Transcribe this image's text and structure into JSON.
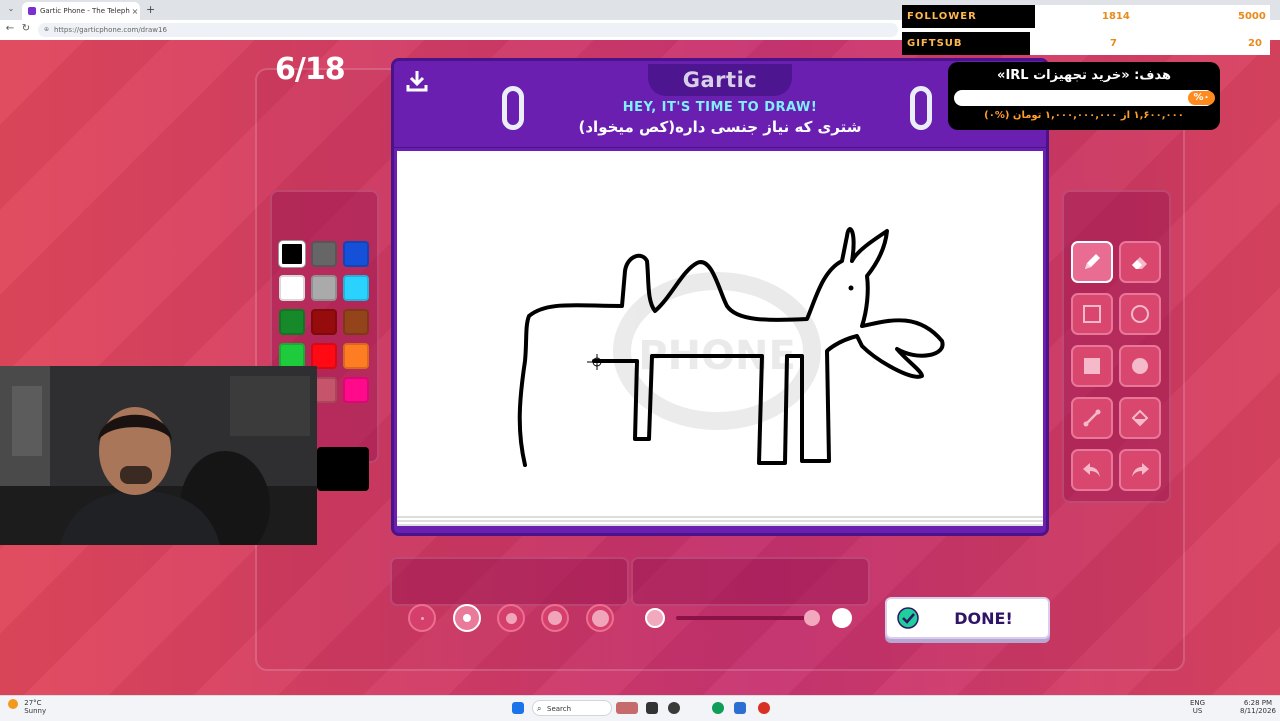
{
  "browser": {
    "tab_title": "Gartic Phone - The Telephone Gar...",
    "tab_close": "×",
    "new_tab": "+",
    "tab_dropdown": "⌄",
    "back": "←",
    "reload": "↻",
    "url": "https://garticphone.com/draw16",
    "lock": "⊕"
  },
  "game": {
    "round": "6/18",
    "logo": "Gartic",
    "heading": "HEY, IT'S TIME TO DRAW!",
    "prompt": "شتری که نیاز جنسی داره(کص میخواد)",
    "watermark": "PHONE",
    "done_label": "DONE!",
    "palette": [
      {
        "color": "#000000",
        "selected": true
      },
      {
        "color": "#666666"
      },
      {
        "color": "#1450d8"
      },
      {
        "color": "#ffffff"
      },
      {
        "color": "#aaaaaa"
      },
      {
        "color": "#2ad2ff"
      },
      {
        "color": "#168a2a"
      },
      {
        "color": "#960c0c"
      },
      {
        "color": "#93441b"
      },
      {
        "color": "#1ecb3c"
      },
      {
        "color": "#ff0a14"
      },
      {
        "color": "#ff7d22"
      },
      {
        "color": "#a9145d"
      },
      {
        "color": "#c6546b"
      },
      {
        "color": "#ff0a8b"
      },
      {
        "color": "#ffa9a9"
      }
    ],
    "current_color": "#000000",
    "tools": [
      "pencil",
      "eraser",
      "rectangle-outline",
      "circle-outline",
      "rectangle-fill",
      "circle-fill",
      "line",
      "fill-bucket",
      "undo",
      "redo"
    ],
    "selected_tool": "pencil",
    "brush_sizes": 5,
    "selected_brush_size": 2
  },
  "overlay": {
    "follower_label": "FOLLOWER",
    "follower_count": "1814",
    "follower_goal": "5000",
    "giftsub_label": "GIFTSUB",
    "giftsub_count": "7",
    "giftsub_goal": "20",
    "goal_title": "هدف: «خرید تجهیزات IRL»",
    "goal_percent": "%۰",
    "goal_progress": "۱,۶۰۰,۰۰۰ از ۱,۰۰۰,۰۰۰,۰۰۰ تومان (%۰)"
  },
  "taskbar": {
    "temp": "27°C",
    "weather": "Sunny",
    "search": "Search",
    "lang1": "ENG",
    "lang2": "US",
    "time": "6:28 PM",
    "date": "8/11/2026"
  },
  "colors": {
    "panel_purple": "#6b1fb1",
    "accent_cyan": "#7ef0ff",
    "done_text": "#301566",
    "overlay_orange": "#ffb84d"
  }
}
